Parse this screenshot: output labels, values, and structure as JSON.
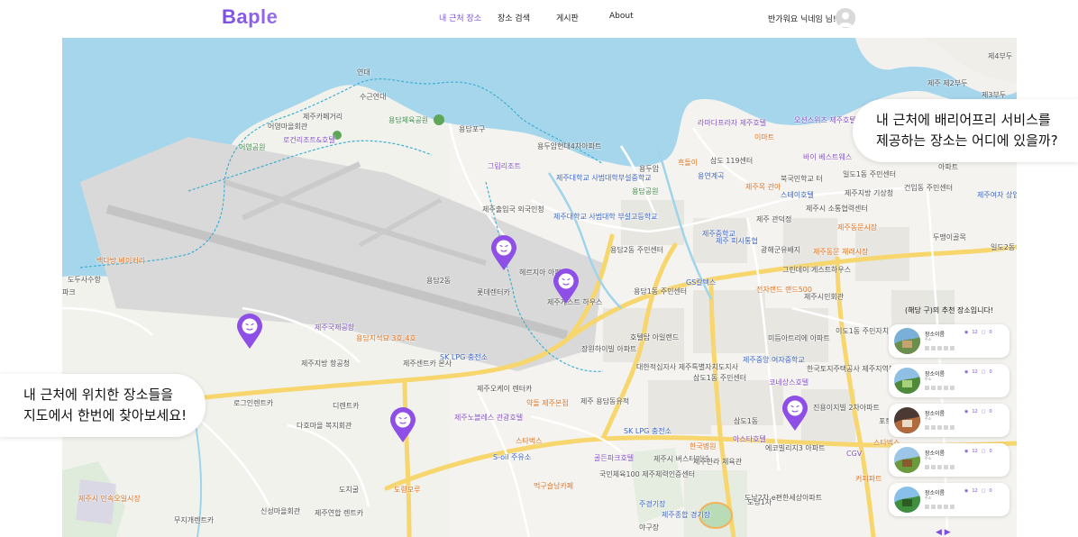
{
  "header": {
    "logo": "Baple",
    "nav": [
      {
        "label": "내 근처 장소",
        "active": true
      },
      {
        "label": "장소 검색",
        "active": false
      },
      {
        "label": "게시판",
        "active": false
      },
      {
        "label": "About",
        "active": false
      }
    ],
    "greeting": "반가워요 닉네임 님!"
  },
  "bubbles": {
    "left": [
      "내 근처에 위치한 장소들을",
      "지도에서 한번에 찾아보세요!"
    ],
    "right": [
      "내 근처에 배리어프리 서비스를",
      "제공하는 장소는 어디에 있을까?"
    ]
  },
  "recommendations": {
    "title": "(해당 구)의 추천 장소입니다!",
    "items": [
      {
        "name": "장소이름",
        "sub": "주소",
        "likes": "12",
        "reviews": "0"
      },
      {
        "name": "장소이름",
        "sub": "주소",
        "likes": "12",
        "reviews": "0"
      },
      {
        "name": "장소이름",
        "sub": "주소",
        "likes": "12",
        "reviews": "0"
      },
      {
        "name": "장소이름",
        "sub": "주소",
        "likes": "12",
        "reviews": "0"
      },
      {
        "name": "장소이름",
        "sub": "주소",
        "likes": "12",
        "reviews": "0"
      }
    ],
    "pager": "◀ ▶"
  },
  "map_labels": [
    {
      "text": "연대",
      "c": ""
    },
    {
      "text": "수근연대",
      "c": ""
    },
    {
      "text": "제주카페거리",
      "c": ""
    },
    {
      "text": "어영마을회관",
      "c": ""
    },
    {
      "text": "어영공원",
      "c": "green"
    },
    {
      "text": "로건리조트&호텔",
      "c": "purple"
    },
    {
      "text": "용담체육공원",
      "c": "green"
    },
    {
      "text": "용담포구",
      "c": ""
    },
    {
      "text": "용두암현대4차아파트",
      "c": ""
    },
    {
      "text": "그림리조트",
      "c": "purple"
    },
    {
      "text": "제주출입국 외국인청",
      "c": ""
    },
    {
      "text": "제주대학교 사범대학부설중학교",
      "c": "blue"
    },
    {
      "text": "용담공원",
      "c": "green"
    },
    {
      "text": "제주대학교 사범대학 부설고등학교",
      "c": "blue"
    },
    {
      "text": "용담2동 주민센터",
      "c": ""
    },
    {
      "text": "헤르지아 아파트",
      "c": ""
    },
    {
      "text": "롯데렌터카",
      "c": ""
    },
    {
      "text": "제주게스트 하우스",
      "c": ""
    },
    {
      "text": "용담2동",
      "c": ""
    },
    {
      "text": "용담1동 주민센터",
      "c": ""
    },
    {
      "text": "제주국제공항",
      "c": "purple"
    },
    {
      "text": "용담지석묘 3호,4호",
      "c": "orange"
    },
    {
      "text": "제주지방 항공청",
      "c": ""
    },
    {
      "text": "제주센트카 본사",
      "c": ""
    },
    {
      "text": "SK LPG 충전소",
      "c": "blue"
    },
    {
      "text": "장원하이빌 아파트",
      "c": ""
    },
    {
      "text": "대한적십자사 제주특별자치도지사",
      "c": ""
    },
    {
      "text": "삼도1동 주민센터",
      "c": ""
    },
    {
      "text": "호텔탑 아일랜드",
      "c": ""
    },
    {
      "text": "제주오케이 렌터카",
      "c": ""
    },
    {
      "text": "로그인렌트카",
      "c": ""
    },
    {
      "text": "디렌트카",
      "c": ""
    },
    {
      "text": "다호마을 복지회관",
      "c": ""
    },
    {
      "text": "제주노블레스 관광호텔",
      "c": "purple"
    },
    {
      "text": "약돌 제주본점",
      "c": "orange"
    },
    {
      "text": "스타벅스",
      "c": "orange"
    },
    {
      "text": "S-oil 주유소",
      "c": "blue"
    },
    {
      "text": "제주 용담동유적",
      "c": ""
    },
    {
      "text": "SK LPG 충전소",
      "c": "blue"
    },
    {
      "text": "골든파크호텔",
      "c": "purple"
    },
    {
      "text": "제주시 버스터미널",
      "c": ""
    },
    {
      "text": "국민체육100 제주체력인증센터",
      "c": ""
    },
    {
      "text": "먹구슬낭카페",
      "c": "orange"
    },
    {
      "text": "도치굴",
      "c": ""
    },
    {
      "text": "도령모루",
      "c": "orange"
    },
    {
      "text": "신성마을회관",
      "c": ""
    },
    {
      "text": "제주연합 렌트카",
      "c": ""
    },
    {
      "text": "무지개렌트카",
      "c": ""
    },
    {
      "text": "제주시 민속오일시장",
      "c": "orange"
    },
    {
      "text": "주경기장",
      "c": "blue"
    },
    {
      "text": "제주종합 경기장",
      "c": "blue"
    },
    {
      "text": "한국병원",
      "c": "orange"
    },
    {
      "text": "아스타호텔",
      "c": "purple"
    },
    {
      "text": "에코빌리지3 아파트",
      "c": ""
    },
    {
      "text": "진용이지빌 2차아파트",
      "c": ""
    },
    {
      "text": "삼도1동",
      "c": ""
    },
    {
      "text": "도남2차 e편한세상아파트",
      "c": ""
    },
    {
      "text": "미듬아트리에 아파트",
      "c": ""
    },
    {
      "text": "제주중앙 여자중학교",
      "c": "blue"
    },
    {
      "text": "한국토지주택공사 제주지역본부",
      "c": ""
    },
    {
      "text": "코네상스호텔",
      "c": "purple"
    },
    {
      "text": "이도1동 주민자치센터",
      "c": ""
    },
    {
      "text": "제주시민회관",
      "c": ""
    },
    {
      "text": "그린데이 게스트하우스",
      "c": ""
    },
    {
      "text": "전자랜드 랜드500",
      "c": "orange"
    },
    {
      "text": "GS칼텍스",
      "c": "blue"
    },
    {
      "text": "제주중학교",
      "c": "blue"
    },
    {
      "text": "제주 피시통협",
      "c": "blue"
    },
    {
      "text": "광해군유배지",
      "c": ""
    },
    {
      "text": "제주동문 재래시장",
      "c": "orange"
    },
    {
      "text": "제주시 소통협력센터",
      "c": ""
    },
    {
      "text": "제주동문시장",
      "c": "orange"
    },
    {
      "text": "제주 관덕정",
      "c": ""
    },
    {
      "text": "용연계곡",
      "c": "blue"
    },
    {
      "text": "흑돌이",
      "c": "orange"
    },
    {
      "text": "용두암",
      "c": ""
    },
    {
      "text": "삼도 119센터",
      "c": ""
    },
    {
      "text": "북국민학교 터",
      "c": ""
    },
    {
      "text": "제주목 관아",
      "c": "orange"
    },
    {
      "text": "스테이호텔",
      "c": "blue"
    },
    {
      "text": "라마다프라자 제주호텔",
      "c": "purple"
    },
    {
      "text": "이마트",
      "c": "orange"
    },
    {
      "text": "오션스위츠 제주호텔",
      "c": "purple"
    },
    {
      "text": "바이 베스트웨스",
      "c": "purple"
    },
    {
      "text": "일도1동 주민센터",
      "c": ""
    },
    {
      "text": "제주지방 기상청",
      "c": ""
    },
    {
      "text": "건입동 주민센터",
      "c": ""
    },
    {
      "text": "제주여자 상업고등학교",
      "c": "blue"
    },
    {
      "text": "두맹이골목",
      "c": ""
    },
    {
      "text": "일도2동 (2024)",
      "c": ""
    },
    {
      "text": "제주 제2부두",
      "c": ""
    },
    {
      "text": "제3부두",
      "c": ""
    },
    {
      "text": "제4부두",
      "c": ""
    },
    {
      "text": "아파트",
      "c": ""
    },
    {
      "text": "스타벅스",
      "c": "orange"
    },
    {
      "text": "도두사수항",
      "c": ""
    },
    {
      "text": "백다방 베이커리",
      "c": "orange"
    },
    {
      "text": "파크",
      "c": ""
    },
    {
      "text": "CGV",
      "c": "purple"
    },
    {
      "text": "커피파트",
      "c": "orange"
    },
    {
      "text": "도남1차",
      "c": ""
    },
    {
      "text": "포트빌",
      "c": ""
    },
    {
      "text": "제주한라 체육관",
      "c": ""
    },
    {
      "text": "야구장",
      "c": ""
    }
  ]
}
